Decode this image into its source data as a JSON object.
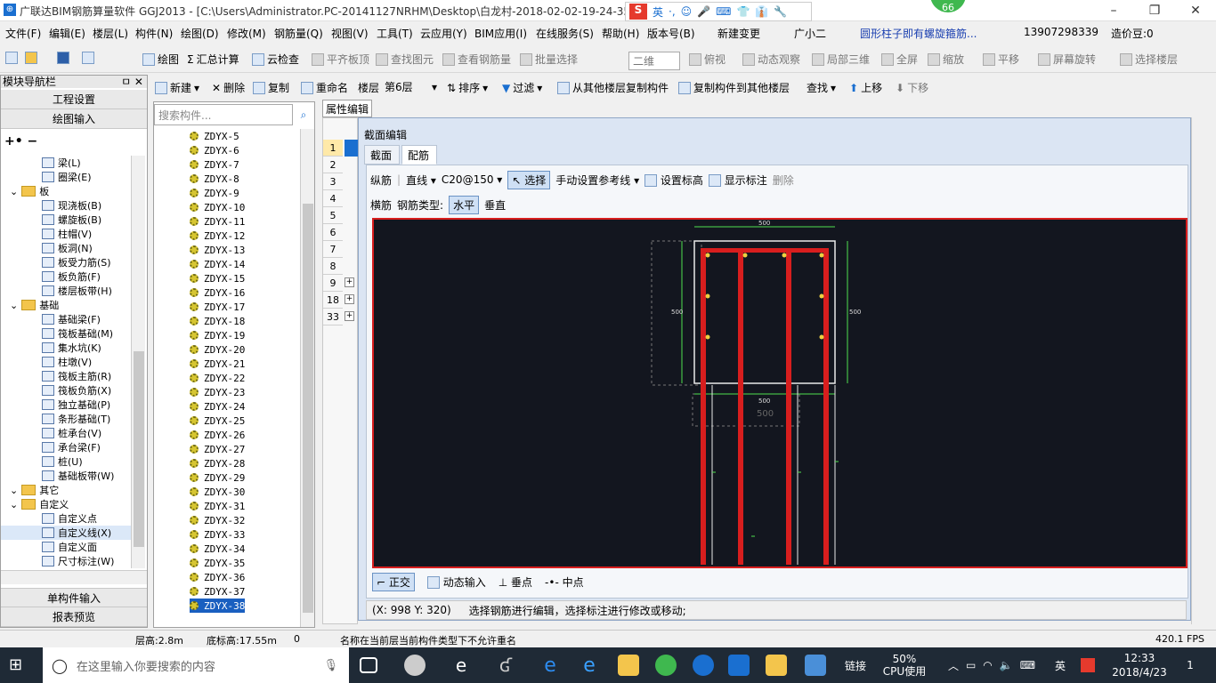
{
  "window": {
    "title": "广联达BIM钢筋算量软件 GGJ2013 - [C:\\Users\\Administrator.PC-20141127NRHM\\Desktop\\白龙村-2018-02-02-19-24-35",
    "app_icon": "bim-app-icon",
    "min": "–",
    "max": "❐",
    "close": "✕"
  },
  "ime": {
    "logo": "S",
    "lang": "英",
    "items": [
      "·,",
      "☺",
      "🎤",
      "⌨",
      "👕",
      "👔",
      "🔧"
    ]
  },
  "badge": "66",
  "menu": [
    "文件(F)",
    "编辑(E)",
    "楼层(L)",
    "构件(N)",
    "绘图(D)",
    "修改(M)",
    "钢筋量(Q)",
    "视图(V)",
    "工具(T)",
    "云应用(Y)",
    "BIM应用(I)",
    "在线服务(S)",
    "帮助(H)",
    "版本号(B)",
    "新建变更",
    "广小二",
    "圆形柱子即有螺旋箍筋...",
    "13907298339",
    "造价豆:0"
  ],
  "toolbar": {
    "draw": "绘图",
    "sum": "汇总计算",
    "cloud": "云检查",
    "flat": "平齐板顶",
    "find_elem": "查找图元",
    "view_rebar": "查看钢筋量",
    "batch": "批量选择",
    "view_mode": "二维",
    "top": "俯视",
    "dynamic": "动态观察",
    "local3d": "局部三维",
    "fullscreen": "全屏",
    "zoom": "缩放",
    "pan": "平移",
    "rotate": "屏幕旋转",
    "select_floor": "选择楼层"
  },
  "actions": {
    "new": "新建",
    "delete": "删除",
    "copy": "复制",
    "rename": "重命名",
    "floor_label": "楼层",
    "floor": "第6层",
    "sort": "排序",
    "filter": "过滤",
    "copy_from": "从其他楼层复制构件",
    "copy_to": "复制构件到其他楼层",
    "find": "查找",
    "up": "上移",
    "down": "下移"
  },
  "nav": {
    "title": "模块导航栏",
    "pin": "ㅁ ✕",
    "project": "工程设置",
    "draw_input": "绘图输入",
    "single_input": "单构件输入",
    "report": "报表预览",
    "tree": [
      {
        "label": "梁(L)",
        "indent": 2
      },
      {
        "label": "圈梁(E)",
        "indent": 2
      },
      {
        "label": "板",
        "indent": 0,
        "folder": true
      },
      {
        "label": "现浇板(B)",
        "indent": 2
      },
      {
        "label": "螺旋板(B)",
        "indent": 2
      },
      {
        "label": "柱帽(V)",
        "indent": 2
      },
      {
        "label": "板洞(N)",
        "indent": 2
      },
      {
        "label": "板受力筋(S)",
        "indent": 2
      },
      {
        "label": "板负筋(F)",
        "indent": 2
      },
      {
        "label": "楼层板带(H)",
        "indent": 2
      },
      {
        "label": "基础",
        "indent": 0,
        "folder": true
      },
      {
        "label": "基础梁(F)",
        "indent": 2
      },
      {
        "label": "筏板基础(M)",
        "indent": 2
      },
      {
        "label": "集水坑(K)",
        "indent": 2
      },
      {
        "label": "柱墩(V)",
        "indent": 2
      },
      {
        "label": "筏板主筋(R)",
        "indent": 2
      },
      {
        "label": "筏板负筋(X)",
        "indent": 2
      },
      {
        "label": "独立基础(P)",
        "indent": 2
      },
      {
        "label": "条形基础(T)",
        "indent": 2
      },
      {
        "label": "桩承台(V)",
        "indent": 2
      },
      {
        "label": "承台梁(F)",
        "indent": 2
      },
      {
        "label": "桩(U)",
        "indent": 2
      },
      {
        "label": "基础板带(W)",
        "indent": 2
      },
      {
        "label": "其它",
        "indent": 0,
        "folder": true
      },
      {
        "label": "自定义",
        "indent": 0,
        "folder": true
      },
      {
        "label": "自定义点",
        "indent": 2
      },
      {
        "label": "自定义线(X)",
        "indent": 2
      },
      {
        "label": "自定义面",
        "indent": 2
      },
      {
        "label": "尺寸标注(W)",
        "indent": 2
      }
    ]
  },
  "search": {
    "placeholder": "搜索构件..."
  },
  "components": [
    "ZDYX-5",
    "ZDYX-6",
    "ZDYX-7",
    "ZDYX-8",
    "ZDYX-9",
    "ZDYX-10",
    "ZDYX-11",
    "ZDYX-12",
    "ZDYX-13",
    "ZDYX-14",
    "ZDYX-15",
    "ZDYX-16",
    "ZDYX-17",
    "ZDYX-18",
    "ZDYX-19",
    "ZDYX-20",
    "ZDYX-21",
    "ZDYX-22",
    "ZDYX-23",
    "ZDYX-24",
    "ZDYX-25",
    "ZDYX-26",
    "ZDYX-27",
    "ZDYX-28",
    "ZDYX-29",
    "ZDYX-30",
    "ZDYX-31",
    "ZDYX-32",
    "ZDYX-33",
    "ZDYX-34",
    "ZDYX-35",
    "ZDYX-36",
    "ZDYX-37",
    "ZDYX-38"
  ],
  "selected_component": "ZDYX-38",
  "props": {
    "tab": "属性编辑",
    "rows": [
      "1",
      "2",
      "3",
      "4",
      "5",
      "6",
      "7",
      "8",
      "9",
      "18",
      "33"
    ],
    "expand": "+"
  },
  "dialog": {
    "title": "截面编辑",
    "tabs": [
      "截面",
      "配筋"
    ],
    "longbar": "纵筋",
    "line": "直线",
    "spec": "C20@150",
    "select": "选择",
    "manual_ref": "手动设置参考线",
    "set_height": "设置标高",
    "show_label": "显示标注",
    "delete": "删除",
    "hbar": "横筋",
    "bar_type_label": "钢筋类型:",
    "horizontal": "水平",
    "vertical": "垂直",
    "dims": {
      "top": "500",
      "left": "500",
      "right": "500",
      "bottom": "500",
      "ghost": "500"
    },
    "snaps": [
      "正交",
      "动态输入",
      "垂点",
      "中点"
    ],
    "coords": "(X: 998 Y: 320)",
    "hint": "选择钢筋进行编辑，选择标注进行修改或移动;"
  },
  "status": {
    "floor_h": "层高:2.8m",
    "base_h": "底标高:17.55m",
    "zero": "0",
    "msg": "名称在当前层当前构件类型下不允许重名",
    "fps": "420.1 FPS"
  },
  "taskbar": {
    "search": "在这里输入你要搜索的内容",
    "link": "链接",
    "cpu": "50%",
    "cpu_label": "CPU使用",
    "lang": "英",
    "time": "12:33",
    "date": "2018/4/23",
    "notif": "1"
  },
  "colors": {
    "rebar": "#d81e1e",
    "canvas": "#13161f",
    "dim": "#4fe04f",
    "accent": "#1a6fd0"
  }
}
